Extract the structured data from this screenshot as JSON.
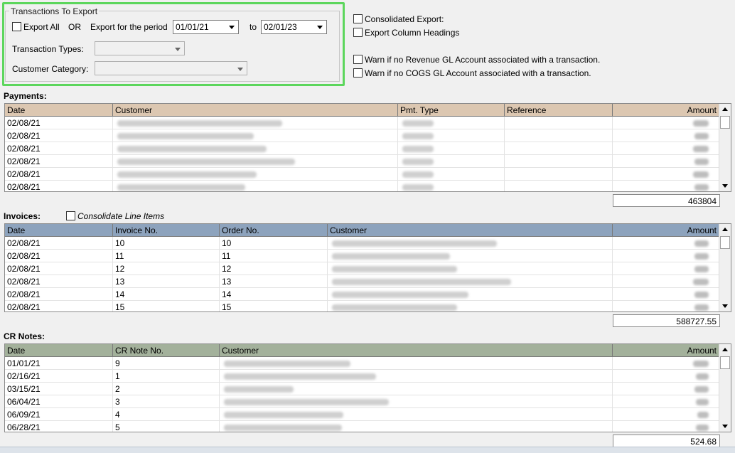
{
  "export_group": {
    "title": "Transactions To Export",
    "export_all_label": "Export All",
    "or_label": "OR",
    "period_label": "Export for the period",
    "from_date": "01/01/21",
    "to_label": "to",
    "to_date": "02/01/23",
    "transaction_types_label": "Transaction Types:",
    "transaction_types_value": "",
    "customer_category_label": "Customer Category:",
    "customer_category_value": ""
  },
  "options": {
    "consolidated_export": "Consolidated Export:",
    "export_column_headings": "Export Column Headings",
    "warn_revenue": "Warn if no Revenue GL Account associated with a transaction.",
    "warn_cogs": "Warn if no COGS GL Account associated with a transaction."
  },
  "payments": {
    "label": "Payments:",
    "header_color": "#dcc7b1",
    "columns": [
      "Date",
      "Customer",
      "Pmt. Type",
      "Reference",
      "Amount"
    ],
    "rows": [
      {
        "date": "02/08/21"
      },
      {
        "date": "02/08/21"
      },
      {
        "date": "02/08/21"
      },
      {
        "date": "02/08/21"
      },
      {
        "date": "02/08/21"
      },
      {
        "date": "02/08/21"
      }
    ],
    "total": "463804"
  },
  "invoices": {
    "label": "Invoices:",
    "consolidate_label": "Consolidate Line Items",
    "header_color": "#8da3bd",
    "columns": [
      "Date",
      "Invoice No.",
      "Order No.",
      "Customer",
      "Amount"
    ],
    "rows": [
      {
        "date": "02/08/21",
        "invoice": "10",
        "order": "10"
      },
      {
        "date": "02/08/21",
        "invoice": "11",
        "order": "11"
      },
      {
        "date": "02/08/21",
        "invoice": "12",
        "order": "12"
      },
      {
        "date": "02/08/21",
        "invoice": "13",
        "order": "13"
      },
      {
        "date": "02/08/21",
        "invoice": "14",
        "order": "14"
      },
      {
        "date": "02/08/21",
        "invoice": "15",
        "order": "15"
      }
    ],
    "total": "588727.55"
  },
  "cr_notes": {
    "label": "CR Notes:",
    "header_color": "#a3b19b",
    "columns": [
      "Date",
      "CR Note No.",
      "Customer",
      "Amount"
    ],
    "rows": [
      {
        "date": "01/01/21",
        "note": "9"
      },
      {
        "date": "02/16/21",
        "note": "1"
      },
      {
        "date": "03/15/21",
        "note": "2"
      },
      {
        "date": "06/04/21",
        "note": "3"
      },
      {
        "date": "06/09/21",
        "note": "4"
      },
      {
        "date": "06/28/21",
        "note": "5"
      }
    ],
    "total": "524.68"
  },
  "icons": {
    "scroll_up": "scroll-up-icon",
    "scroll_down": "scroll-down-icon",
    "dropdown": "chevron-down-icon"
  },
  "colors": {
    "highlight_border": "#5cd65c"
  }
}
